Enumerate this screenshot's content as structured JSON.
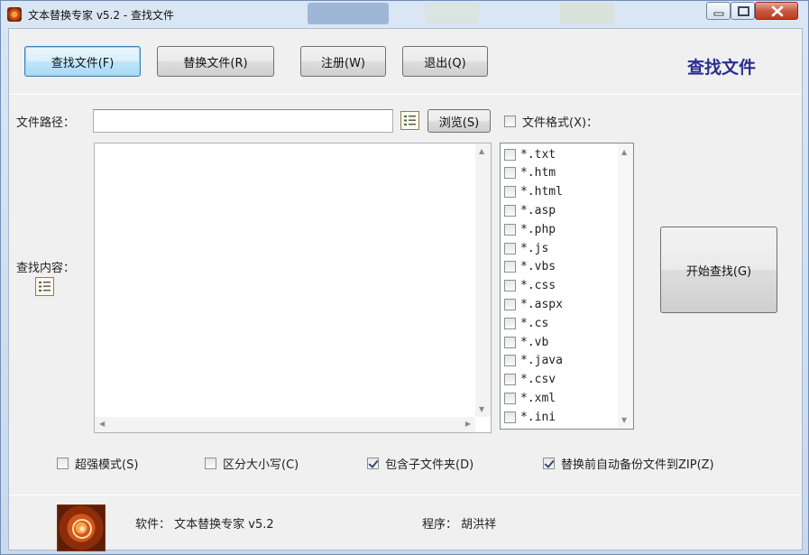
{
  "window": {
    "title": "文本替换专家 v5.2 - 查找文件",
    "controls": {
      "minimize": "minimize-icon",
      "maximize": "maximize-icon",
      "close": "close-icon"
    }
  },
  "toolbar": {
    "find_files": "查找文件(F)",
    "replace_files": "替换文件(R)",
    "register": "注册(W)",
    "exit": "退出(Q)"
  },
  "page_heading": "查找文件",
  "path": {
    "label": "文件路径：",
    "value": "",
    "browse": "浏览(S)"
  },
  "file_format": {
    "label": "文件格式(X)：",
    "checked": false,
    "items": [
      "*.txt",
      "*.htm",
      "*.html",
      "*.asp",
      "*.php",
      "*.js",
      "*.vbs",
      "*.css",
      "*.aspx",
      "*.cs",
      "*.vb",
      "*.java",
      "*.csv",
      "*.xml",
      "*.ini"
    ]
  },
  "find_content": {
    "label": "查找内容：",
    "value": ""
  },
  "start_button": "开始查找(G)",
  "options": [
    {
      "label": "超强模式(S)",
      "checked": false
    },
    {
      "label": "区分大小写(C)",
      "checked": false
    },
    {
      "label": "包含子文件夹(D)",
      "checked": true
    },
    {
      "label": "替换前自动备份文件到ZIP(Z)",
      "checked": true
    }
  ],
  "footer": {
    "software": "软件：  文本替换专家 v5.2",
    "programmer": "程序：  胡洪祥"
  },
  "colors": {
    "heading": "#2a2f8f",
    "accent_border": "#3c7fb1"
  }
}
